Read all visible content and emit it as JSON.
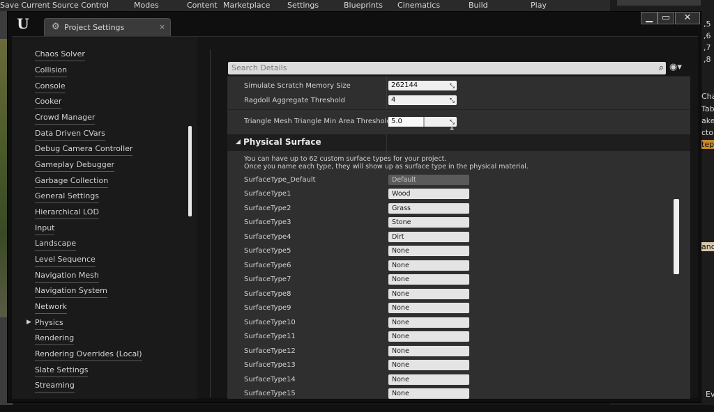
{
  "background": {
    "toolbar": [
      "Save Current",
      "Source Control",
      "Modes",
      "Content",
      "Marketplace",
      "Settings",
      "Blueprints",
      "Cinematics",
      "Build",
      "Play"
    ],
    "right_fragments": [
      ",5",
      ",6",
      ",7",
      ",8",
      "Cha",
      "Tab",
      "ake",
      "cto",
      "tep",
      "and",
      "Eve"
    ]
  },
  "window": {
    "tab_title": "Project Settings",
    "tab_close": "×",
    "buttons": {
      "minimize": "▁",
      "maximize": "▭",
      "close": "✕"
    }
  },
  "sidebar": {
    "items": [
      "Chaos Solver",
      "Collision",
      "Console",
      "Cooker",
      "Crowd Manager",
      "Data Driven CVars",
      "Debug Camera Controller",
      "Gameplay Debugger",
      "Garbage Collection",
      "General Settings",
      "Hierarchical LOD",
      "Input",
      "Landscape",
      "Level Sequence",
      "Navigation Mesh",
      "Navigation System",
      "Network",
      "Physics",
      "Rendering",
      "Rendering Overrides (Local)",
      "Slate Settings",
      "Streaming"
    ],
    "selected": "Physics"
  },
  "search": {
    "placeholder": "Search Details"
  },
  "details": {
    "rows": [
      {
        "label": "Simulate Scratch Memory Size",
        "value": "262144"
      },
      {
        "label": "Ragdoll Aggregate Threshold",
        "value": "4"
      },
      {
        "label": "Triangle Mesh Triangle Min Area Threshold",
        "value": "5.0"
      }
    ],
    "section_title": "Physical Surface",
    "desc1": "You can have up to 62 custom surface types for your project.",
    "desc2": "Once you name each type, they will show up as surface type in the physical material.",
    "surfaces": [
      {
        "label": "SurfaceType_Default",
        "value": "Default"
      },
      {
        "label": "SurfaceType1",
        "value": "Wood"
      },
      {
        "label": "SurfaceType2",
        "value": "Grass"
      },
      {
        "label": "SurfaceType3",
        "value": "Stone"
      },
      {
        "label": "SurfaceType4",
        "value": "Dirt"
      },
      {
        "label": "SurfaceType5",
        "value": "None"
      },
      {
        "label": "SurfaceType6",
        "value": "None"
      },
      {
        "label": "SurfaceType7",
        "value": "None"
      },
      {
        "label": "SurfaceType8",
        "value": "None"
      },
      {
        "label": "SurfaceType9",
        "value": "None"
      },
      {
        "label": "SurfaceType10",
        "value": "None"
      },
      {
        "label": "SurfaceType11",
        "value": "None"
      },
      {
        "label": "SurfaceType12",
        "value": "None"
      },
      {
        "label": "SurfaceType13",
        "value": "None"
      },
      {
        "label": "SurfaceType14",
        "value": "None"
      },
      {
        "label": "SurfaceType15",
        "value": "None"
      }
    ]
  }
}
